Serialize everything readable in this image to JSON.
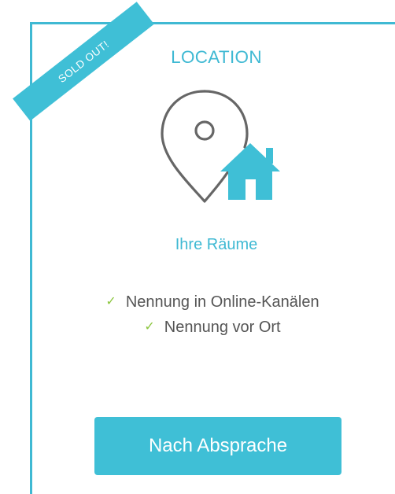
{
  "ribbon": {
    "label": "SOLD OUT!"
  },
  "card": {
    "title": "LOCATION",
    "icon": "location-pin-house-icon",
    "subtitle": "Ihre Räume",
    "features": [
      {
        "icon": "check-icon",
        "label": "Nennung in Online-Kanälen"
      },
      {
        "icon": "check-icon",
        "label": "Nennung vor Ort"
      }
    ],
    "cta_label": "Nach Absprache"
  },
  "colors": {
    "accent": "#3fb9d3",
    "button": "#3fbfd6",
    "check": "#8cc63f",
    "text": "#555555",
    "icon_stroke": "#666666"
  }
}
